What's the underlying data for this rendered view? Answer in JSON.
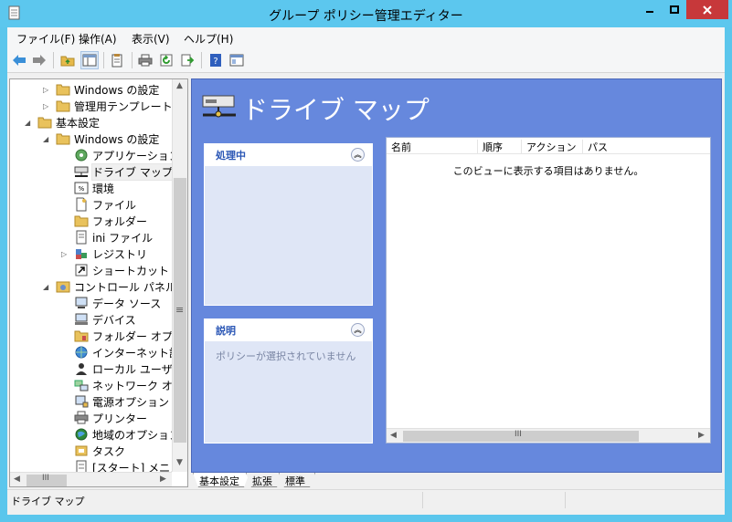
{
  "window": {
    "title": "グループ ポリシー管理エディター"
  },
  "menu": [
    "ファイル(F)",
    "操作(A)",
    "表示(V)",
    "ヘルプ(H)"
  ],
  "toolbar": [
    "back-icon",
    "forward-icon",
    "up-folder-icon",
    "show-hide-tree-icon",
    "properties-icon",
    "print-icon",
    "refresh-icon",
    "export-list-icon",
    "help-icon",
    "console-icon"
  ],
  "tree": {
    "items": [
      {
        "label": "Windows の設定",
        "level": 2,
        "expander": "▷",
        "icon": "folder-icon",
        "selected": false
      },
      {
        "label": "管理用テンプレート",
        "level": 2,
        "expander": "▷",
        "icon": "folder-icon",
        "selected": false
      },
      {
        "label": "基本設定",
        "level": 1,
        "expander": "◢",
        "icon": "folder-icon",
        "selected": false
      },
      {
        "label": "Windows の設定",
        "level": 2,
        "expander": "◢",
        "icon": "folder-icon",
        "selected": false
      },
      {
        "label": "アプリケーション",
        "level": 3,
        "expander": "",
        "icon": "application-icon",
        "selected": false
      },
      {
        "label": "ドライブ マップ",
        "level": 3,
        "expander": "",
        "icon": "drive-map-icon",
        "selected": true
      },
      {
        "label": "環境",
        "level": 3,
        "expander": "",
        "icon": "environment-icon",
        "selected": false
      },
      {
        "label": "ファイル",
        "level": 3,
        "expander": "",
        "icon": "file-icon",
        "selected": false
      },
      {
        "label": "フォルダー",
        "level": 3,
        "expander": "",
        "icon": "folder-icon",
        "selected": false
      },
      {
        "label": "ini ファイル",
        "level": 3,
        "expander": "",
        "icon": "ini-file-icon",
        "selected": false
      },
      {
        "label": "レジストリ",
        "level": 3,
        "expander": "▷",
        "icon": "registry-icon",
        "selected": false
      },
      {
        "label": "ショートカット",
        "level": 3,
        "expander": "",
        "icon": "shortcut-icon",
        "selected": false
      },
      {
        "label": "コントロール パネルの",
        "level": 2,
        "expander": "◢",
        "icon": "control-panel-icon",
        "selected": false
      },
      {
        "label": "データ ソース",
        "level": 3,
        "expander": "",
        "icon": "data-source-icon",
        "selected": false
      },
      {
        "label": "デバイス",
        "level": 3,
        "expander": "",
        "icon": "device-icon",
        "selected": false
      },
      {
        "label": "フォルダー オプシ",
        "level": 3,
        "expander": "",
        "icon": "folder-options-icon",
        "selected": false
      },
      {
        "label": "インターネット設",
        "level": 3,
        "expander": "",
        "icon": "internet-settings-icon",
        "selected": false
      },
      {
        "label": "ローカル ユーザ",
        "level": 3,
        "expander": "",
        "icon": "local-users-icon",
        "selected": false
      },
      {
        "label": "ネットワーク オプ",
        "level": 3,
        "expander": "",
        "icon": "network-options-icon",
        "selected": false
      },
      {
        "label": "電源オプション",
        "level": 3,
        "expander": "",
        "icon": "power-options-icon",
        "selected": false
      },
      {
        "label": "プリンター",
        "level": 3,
        "expander": "",
        "icon": "printer-icon",
        "selected": false
      },
      {
        "label": "地域のオプション",
        "level": 3,
        "expander": "",
        "icon": "regional-options-icon",
        "selected": false
      },
      {
        "label": "タスク",
        "level": 3,
        "expander": "",
        "icon": "task-icon",
        "selected": false
      },
      {
        "label": "[スタート] メニュ",
        "level": 3,
        "expander": "",
        "icon": "start-menu-icon",
        "selected": false
      }
    ],
    "vscroll_grip": "≡",
    "hscroll_grip": "III"
  },
  "detail": {
    "title": "ドライブ マップ",
    "processing": {
      "title": "処理中",
      "collapse": "︽"
    },
    "description": {
      "title": "説明",
      "text": "ポリシーが選択されていません",
      "collapse": "︽"
    },
    "columns": [
      "名前",
      "順序",
      "アクション",
      "パス"
    ],
    "empty_text": "このビューに表示する項目はありません。",
    "hscroll_grip": "III"
  },
  "tabs": [
    "基本設定",
    "拡張",
    "標準"
  ],
  "status": {
    "text": "ドライブ マップ"
  },
  "colors": {
    "titlebar": "#5cc7ee",
    "close": "#c7383a",
    "pane": "#6688dd",
    "panel": "#dfe6f6"
  }
}
